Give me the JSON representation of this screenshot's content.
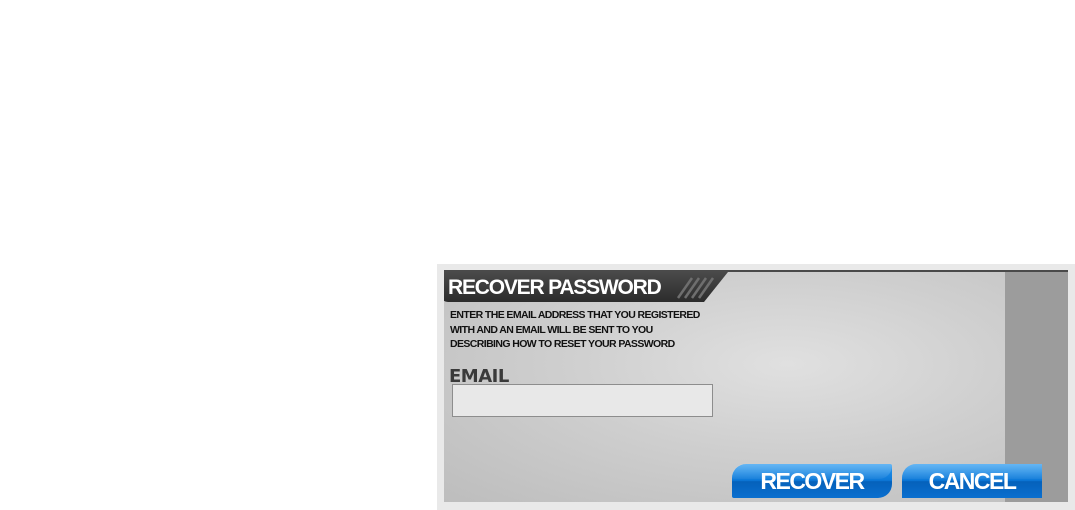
{
  "dialog": {
    "title": "RECOVER PASSWORD",
    "description_lines": [
      "ENTER THE EMAIL ADDRESS THAT YOU REGISTERED",
      "WITH AND AN EMAIL WILL BE SENT TO YOU",
      "DESCRIBING HOW TO RESET YOUR PASSWORD"
    ],
    "email_label": "EMAIL",
    "email_value": "",
    "email_placeholder": "",
    "recover_label": "RECOVER",
    "cancel_label": "CANCEL"
  },
  "colors": {
    "title_bar": "#3b3b3b",
    "button_blue": "#0c78d8",
    "panel_gray": "#cfcfcf"
  }
}
